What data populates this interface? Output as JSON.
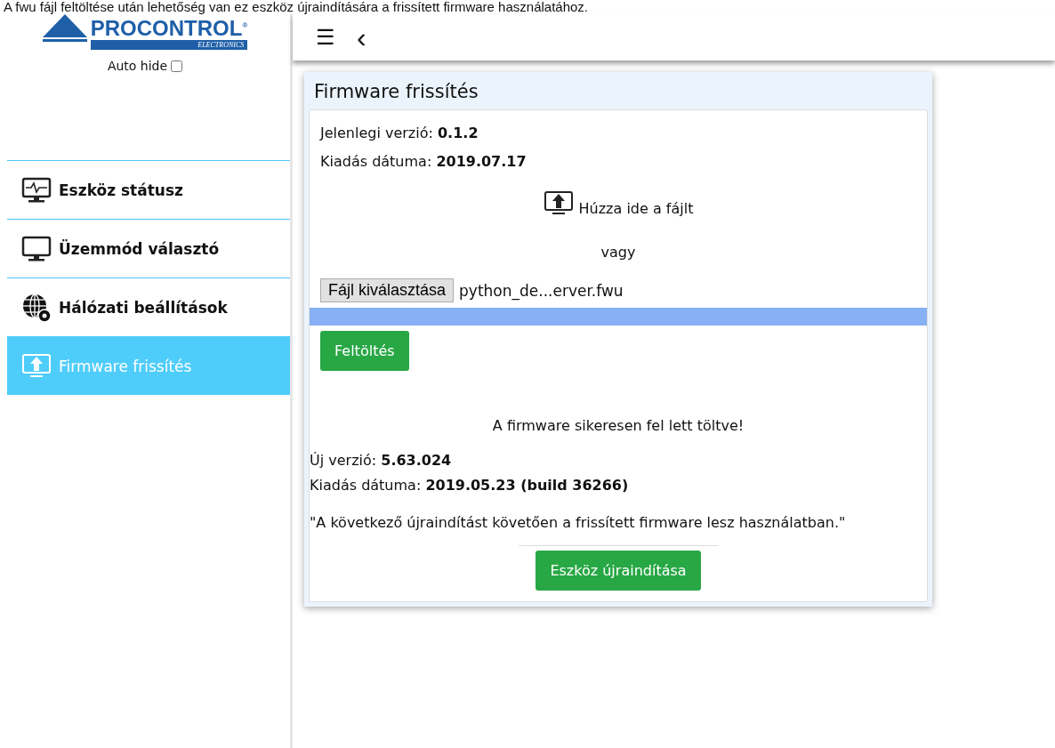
{
  "caption": "A fwu fájl feltöltése után lehetőség van ez eszköz újraindítására a frissített firmware használatához.",
  "logo": {
    "name": "PROCONTROL",
    "sub": "ELECTRONICS",
    "mark": "®"
  },
  "auto_hide": {
    "label": "Auto hide",
    "checked": false
  },
  "sidebar": {
    "items": [
      {
        "label": "Eszköz státusz",
        "kind": "status",
        "selected": false
      },
      {
        "label": "Üzemmód választó",
        "kind": "monitor",
        "selected": false
      },
      {
        "label": "Hálózati beállítások",
        "kind": "network",
        "selected": false
      },
      {
        "label": "Firmware frissítés",
        "kind": "upload",
        "selected": true
      }
    ]
  },
  "header": {
    "menu": "☰",
    "back": "‹"
  },
  "card": {
    "title": "Firmware frissítés",
    "current": [
      {
        "label": "Jelenlegi verzió:",
        "value": "0.1.2"
      },
      {
        "label": "Kiadás dátuma:",
        "value": "2019.07.17"
      }
    ],
    "drop_text": "Húzza ide a fájlt",
    "or": "vagy",
    "file_button": "Fájl kiválasztása",
    "file_name": "python_de...erver.fwu",
    "progress": {
      "level": 1
    },
    "upload_button": "Feltöltés",
    "success": "A firmware sikeresen fel lett töltve!",
    "new": [
      {
        "label": "Új verzió:",
        "value": "5.63.024"
      },
      {
        "label": "Kiadás dátuma:",
        "value": "2019.05.23 (build 36266)"
      }
    ],
    "note": "\"A következő újraindítást követően a frissített firmware lesz használatban.\"",
    "restart_button": "Eszköz újraindítása"
  }
}
